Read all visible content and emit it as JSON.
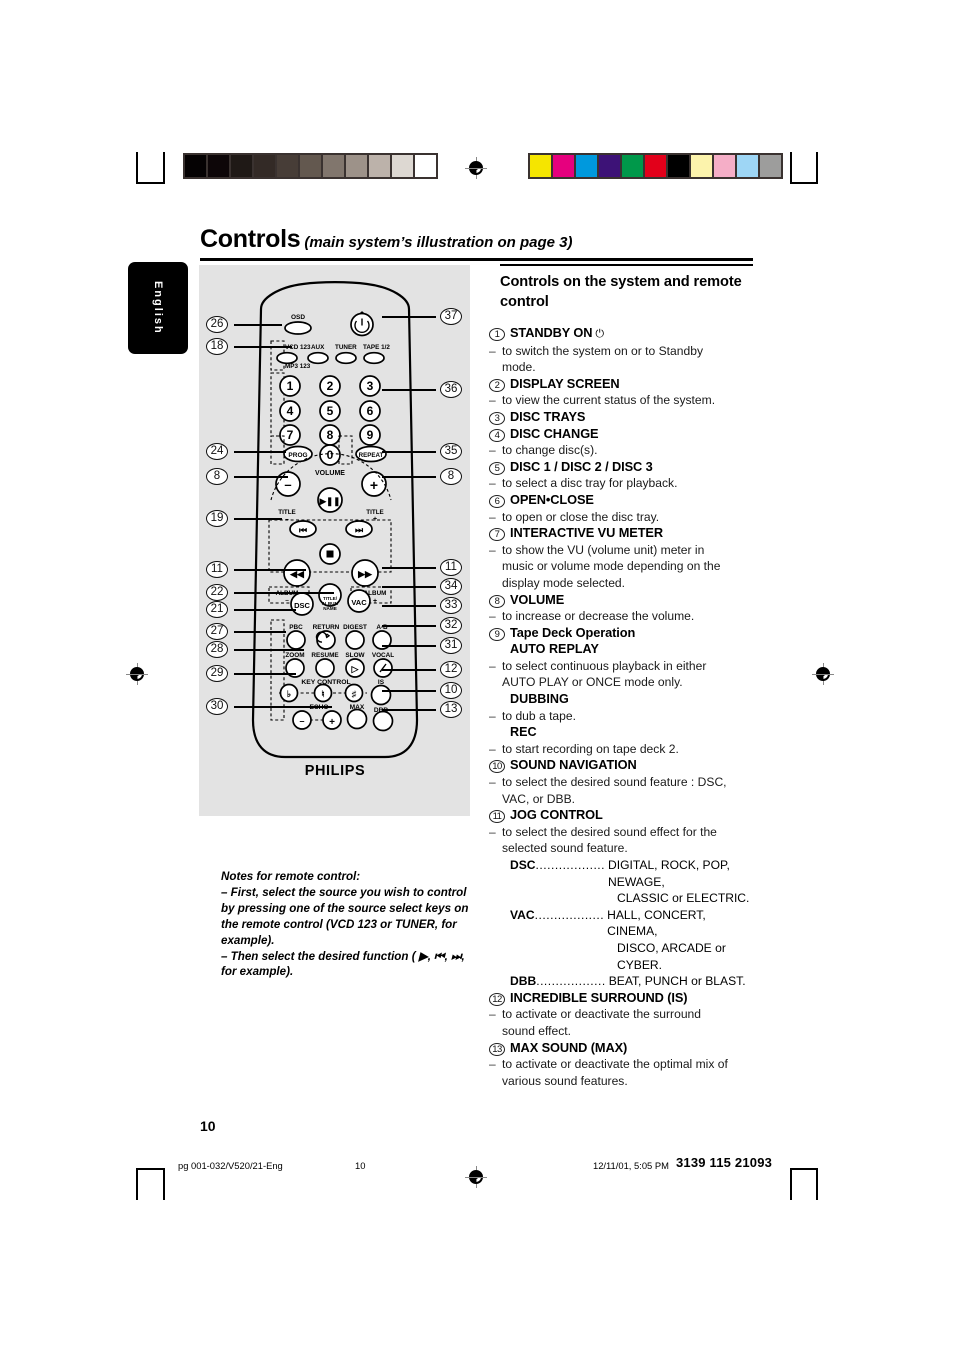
{
  "header": {
    "title": "Controls",
    "subtitle": "(main system’s illustration on page 3)",
    "language_tab": "English"
  },
  "right_column": {
    "section_heading": "Controls on the system and remote control",
    "items": [
      {
        "num": "1",
        "label": "STANDBY ON",
        "glyph": "⏻",
        "descs": [
          "to switch the system on or to Standby mode."
        ]
      },
      {
        "num": "2",
        "label": "DISPLAY SCREEN",
        "descs": [
          "to view the current status of the system."
        ]
      },
      {
        "num": "3",
        "label": "DISC TRAYS",
        "descs": []
      },
      {
        "num": "4",
        "label": "DISC CHANGE",
        "descs": [
          "to change disc(s)."
        ]
      },
      {
        "num": "5",
        "label": "DISC 1 / DISC 2 / DISC 3",
        "descs": [
          "to select a disc tray for playback."
        ]
      },
      {
        "num": "6",
        "label": "OPEN•CLOSE",
        "descs": [
          "to open or close the disc tray."
        ]
      },
      {
        "num": "7",
        "label": "INTERACTIVE VU METER",
        "descs": [
          "to show the VU (volume unit) meter in music or volume mode depending on the display mode selected."
        ]
      },
      {
        "num": "8",
        "label": "VOLUME",
        "descs": [
          "to increase or decrease the volume."
        ]
      },
      {
        "num": "9",
        "label": "Tape Deck Operation",
        "label_weight": "semi",
        "sub_groups": [
          {
            "sub": "AUTO REPLAY",
            "desc": "to select continuous playback in either AUTO PLAY or ONCE mode only."
          },
          {
            "sub": "DUBBING",
            "desc": "to dub a tape."
          },
          {
            "sub": "REC",
            "desc": "to start recording on tape deck 2."
          }
        ]
      },
      {
        "num": "10",
        "label": "SOUND NAVIGATION",
        "descs": [
          "to select the desired sound feature : DSC, VAC, or DBB."
        ]
      },
      {
        "num": "11",
        "label": "JOG CONTROL",
        "descs": [
          "to select the desired sound effect for the selected sound feature."
        ],
        "dsc_table": [
          {
            "key": "DSC",
            "dots": "..................",
            "value": "DIGITAL, ROCK, POP, NEWAGE,",
            "cont": "CLASSIC or ELECTRIC."
          },
          {
            "key": "VAC",
            "dots": "..................",
            "value": "HALL, CONCERT, CINEMA,",
            "cont": "DISCO, ARCADE or CYBER."
          },
          {
            "key": "DBB",
            "dots": "..................",
            "value": "BEAT, PUNCH or BLAST.",
            "cont": ""
          }
        ]
      },
      {
        "num": "12",
        "label": "INCREDIBLE SURROUND (IS)",
        "descs": [
          "to activate or deactivate the surround sound effect."
        ]
      },
      {
        "num": "13",
        "label": "MAX SOUND (MAX)",
        "descs": [
          "to activate or deactivate the optimal mix of various sound features."
        ]
      }
    ]
  },
  "notes": {
    "title": "Notes for remote control:",
    "line1": "–  First, select the source you wish to control by pressing one of the source select keys on the remote control (VCD 123 or TUNER, for example).",
    "line2": "–  Then select the desired function ( ▶,  ⏮,  ⏭, for example)."
  },
  "remote": {
    "brand": "PHILIPS",
    "osd_label": "OSD",
    "power_glyph": "⏻",
    "source_keys": [
      "VCD 123",
      "AUX",
      "TUNER",
      "TAPE 1/2"
    ],
    "source_sub": "MP3 123",
    "numpad": [
      "1",
      "2",
      "3",
      "4",
      "5",
      "6",
      "7",
      "8",
      "9",
      "0"
    ],
    "prog_label": "PROG",
    "repeat_label": "REPEAT",
    "volume_label": "VOLUME",
    "volume_minus": "–",
    "volume_plus": "+",
    "transport": {
      "play_pause": "▶❙❙",
      "prev": "⏮",
      "next": "⏭",
      "stop": "■",
      "rewind": "◀◀",
      "forward": "▶▶"
    },
    "title_minus": "TITLE\n–",
    "title_plus": "TITLE\n+",
    "album_minus": "ALBUM\n–",
    "album_plus": "ALBUM\n+",
    "dsc_button": "DSC",
    "vac_button": "VAC",
    "title_album_name": "TITLE/ ALBUM NAME",
    "row_pbc": [
      "PBC",
      "RETURN",
      "DIGEST",
      "A-B"
    ],
    "row_zoom": [
      "ZOOM",
      "RESUME",
      "SLOW",
      "VOCAL"
    ],
    "key_control": "KEY CONTROL",
    "key_glyphs": [
      "♭",
      "♮",
      "♯"
    ],
    "echo_label": "ECHO",
    "echo_minus": "–",
    "echo_plus": "+",
    "max_label": "MAX",
    "is_label": "IS",
    "dbb_label": "DBB"
  },
  "callouts": {
    "left": [
      "26",
      "18",
      "24",
      "8",
      "19",
      "11",
      "22",
      "21",
      "27",
      "28",
      "29",
      "30"
    ],
    "right": [
      "37",
      "36",
      "35",
      "8",
      "11",
      "34",
      "33",
      "32",
      "31",
      "12",
      "10",
      "13"
    ]
  },
  "footer": {
    "page_number": "10",
    "file_ref": "pg 001-032/V520/21-Eng",
    "mid_page": "10",
    "timestamp": "12/11/01, 5:05 PM",
    "doc_code": "3139 115 21093"
  },
  "color_bars": {
    "gray": [
      "#050203",
      "#0d0608",
      "#1f1916",
      "#332a26",
      "#473d37",
      "#63584f",
      "#81766d",
      "#9d9289",
      "#bcb2aa",
      "#ddd8d2",
      "#ffffff"
    ],
    "color": [
      "#f5e500",
      "#e6007e",
      "#0099dd",
      "#3d1277",
      "#00984a",
      "#e2001a",
      "#000000",
      "#fcf3ac",
      "#f5aec7",
      "#9ed6f5",
      "#9d9d9c"
    ]
  }
}
